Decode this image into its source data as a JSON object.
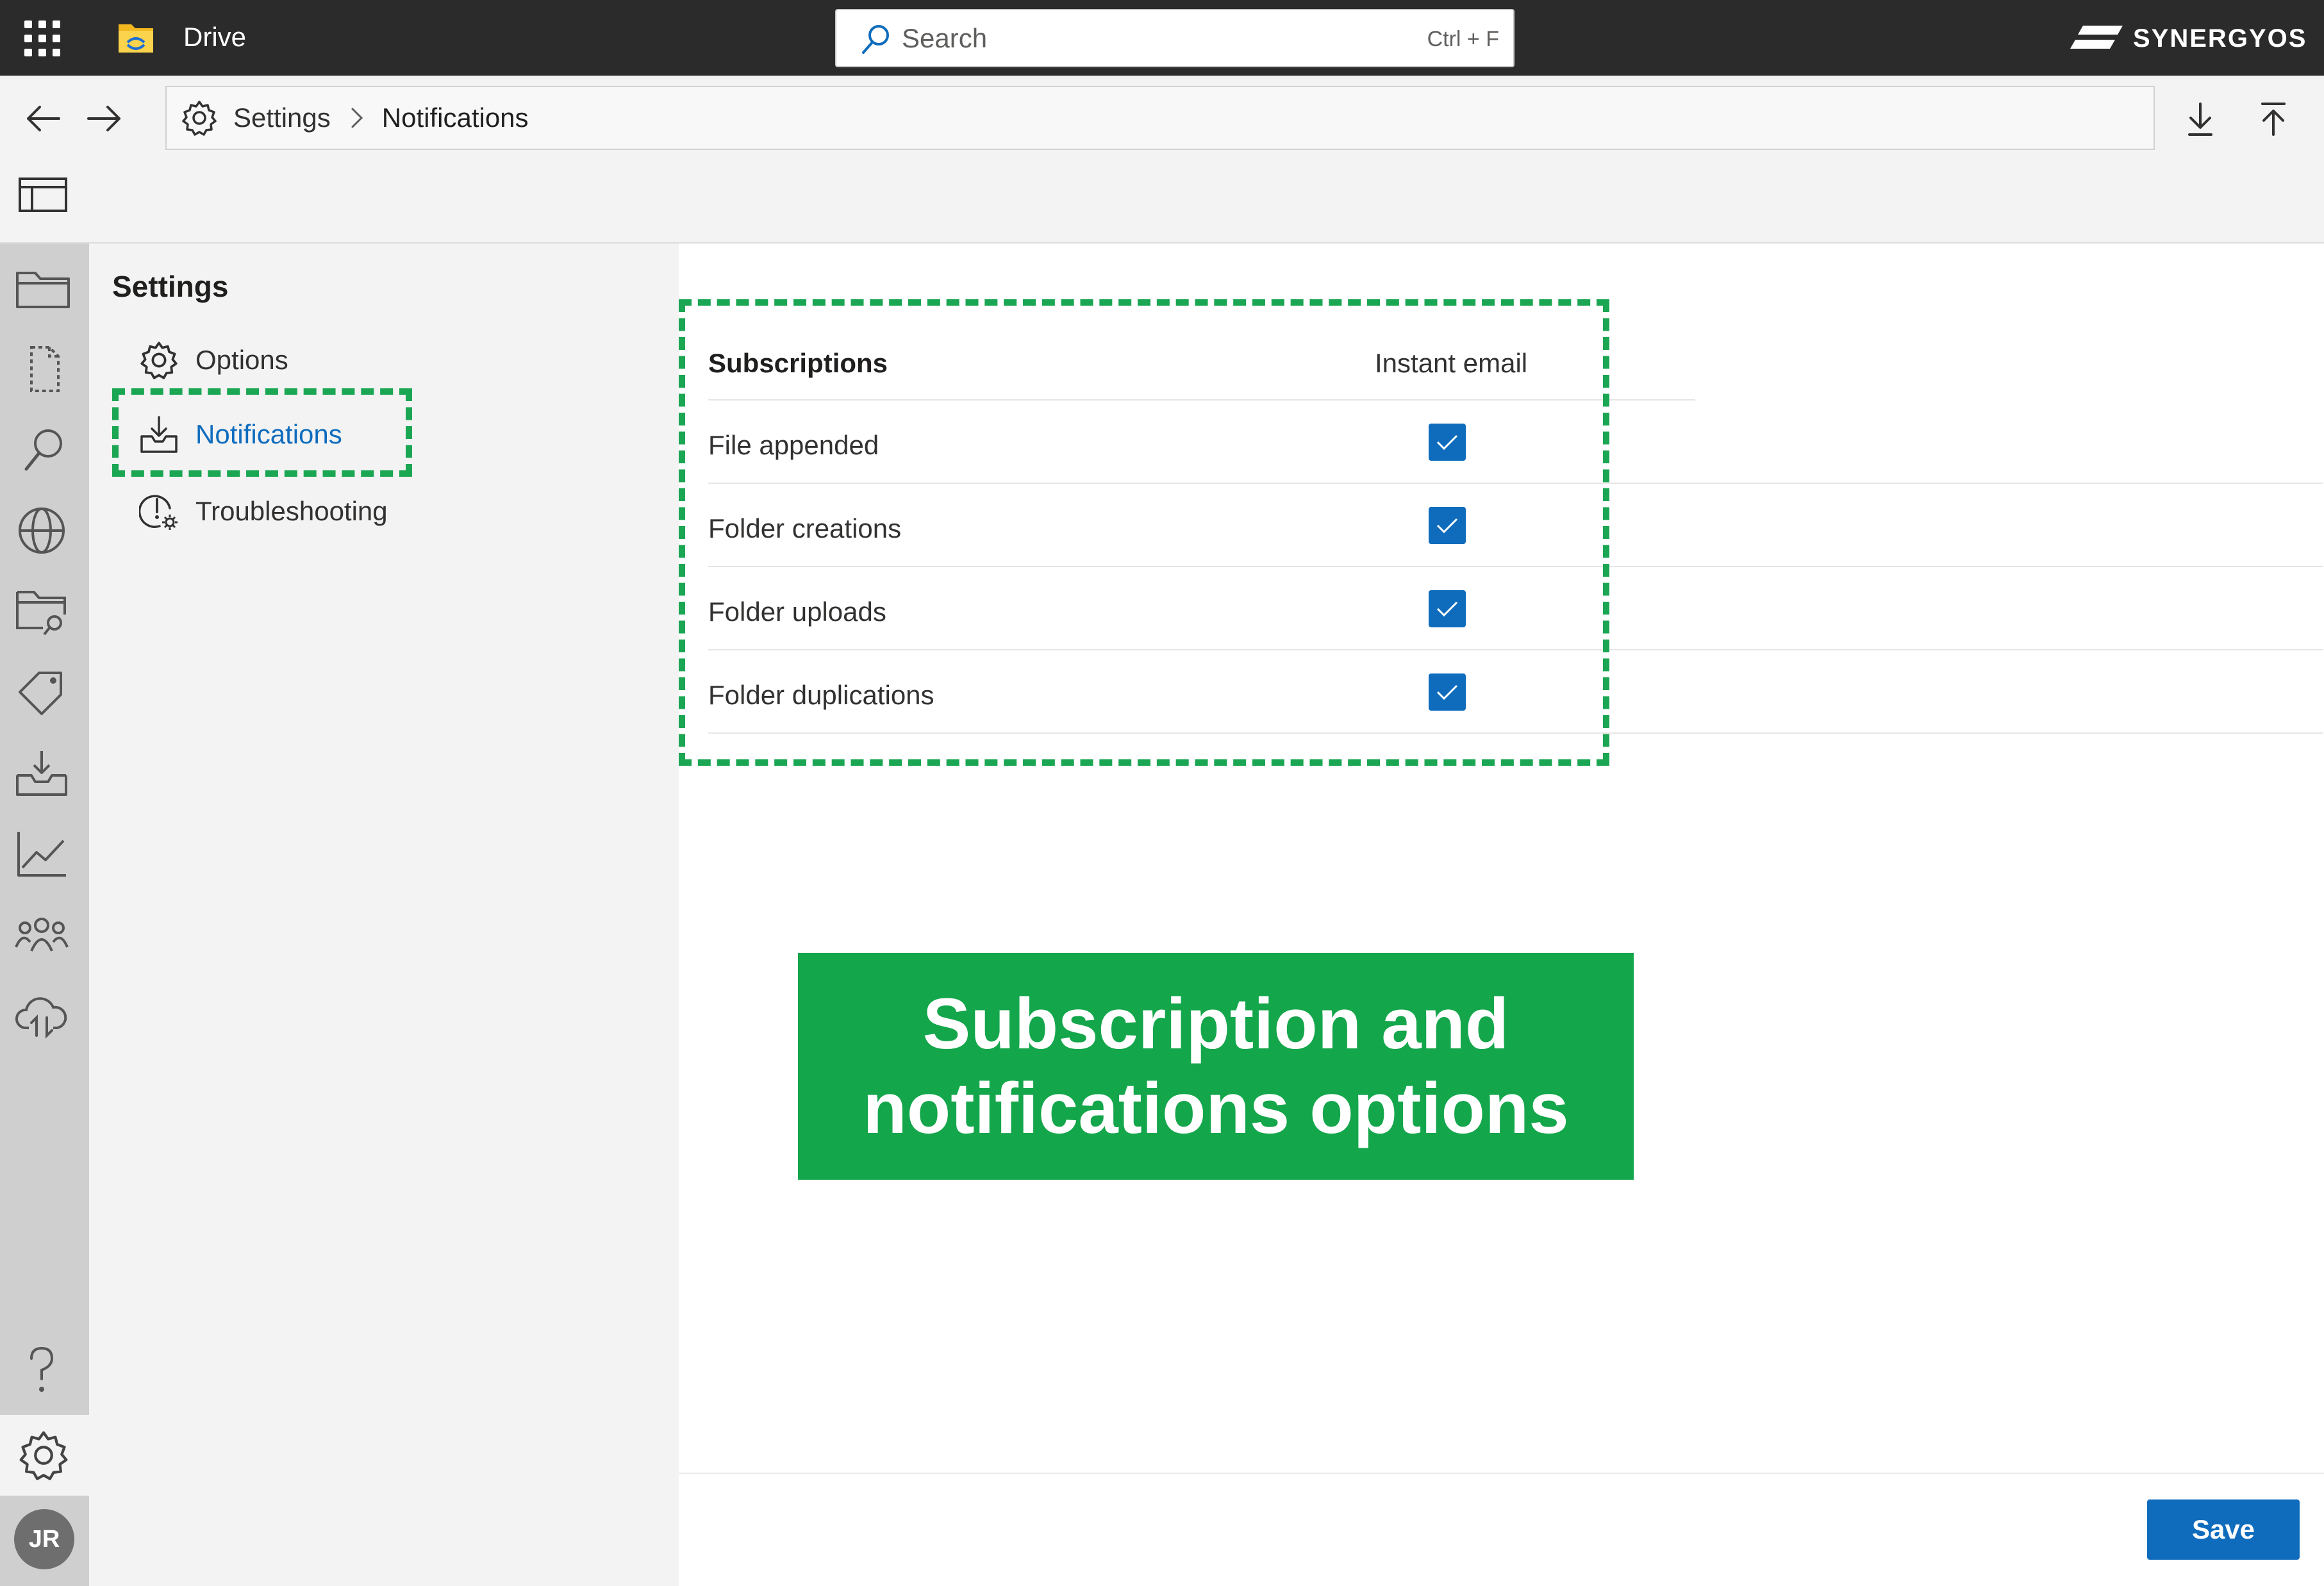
{
  "topbar": {
    "app_title": "Drive",
    "search_placeholder": "Search",
    "search_shortcut": "Ctrl + F",
    "brand_name": "SYNERGYOS"
  },
  "breadcrumb": {
    "root": "Settings",
    "current": "Notifications"
  },
  "settings_nav": {
    "title": "Settings",
    "items": [
      {
        "label": "Options",
        "icon": "gear-icon",
        "active": false
      },
      {
        "label": "Notifications",
        "icon": "inbox-download-icon",
        "active": true
      },
      {
        "label": "Troubleshooting",
        "icon": "alert-gear-icon",
        "active": false
      }
    ]
  },
  "rail": {
    "icons": [
      "folder-icon",
      "document-icon",
      "search-icon",
      "globe-icon",
      "folder-search-icon",
      "tag-icon",
      "inbox-icon",
      "chart-icon",
      "people-icon",
      "cloud-sync-icon",
      "help-icon",
      "gear-icon"
    ],
    "avatar_initials": "JR"
  },
  "subscriptions": {
    "header": "Subscriptions",
    "column": "Instant email",
    "rows": [
      {
        "label": "File appended",
        "instant_email": true
      },
      {
        "label": "Folder creations",
        "instant_email": true
      },
      {
        "label": "Folder uploads",
        "instant_email": true
      },
      {
        "label": "Folder duplications",
        "instant_email": true
      }
    ]
  },
  "annotation": {
    "line1": "Subscription and",
    "line2": "notifications options"
  },
  "footer": {
    "save_label": "Save"
  },
  "colors": {
    "accent": "#0f6cbd",
    "annotation_green": "#14a64b",
    "topbar": "#2b2b2b"
  }
}
